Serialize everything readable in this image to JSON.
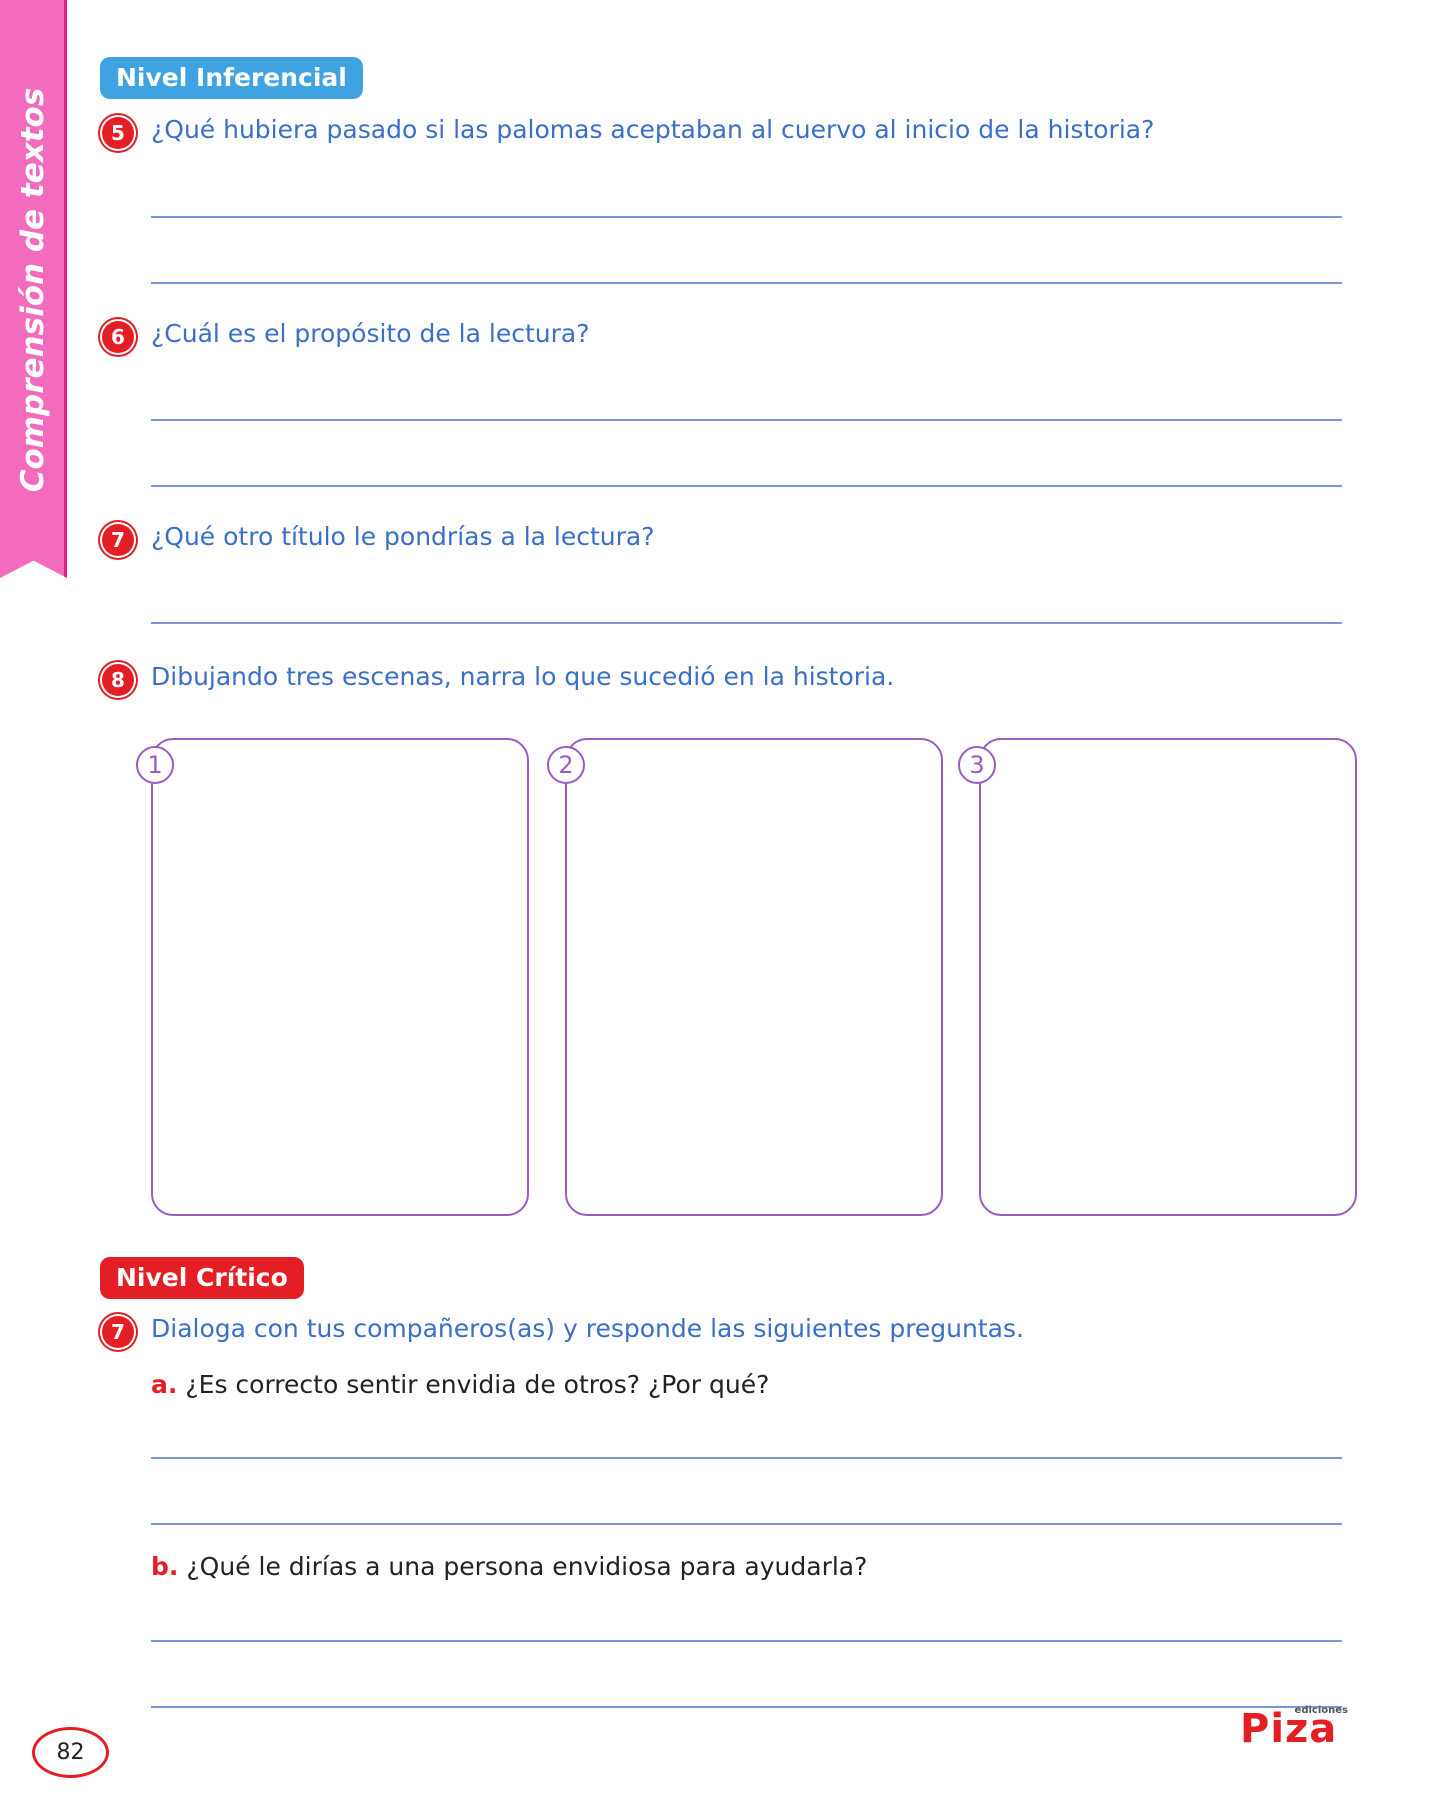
{
  "sidebar": {
    "label": "Comprensión de textos",
    "color": "#f26bbd"
  },
  "inferencial": {
    "badge": "Nivel Inferencial",
    "badge_color": "#3ea3e0",
    "questions": [
      {
        "number": "5",
        "text": "¿Qué hubiera pasado si las palomas aceptaban al cuervo al inicio de la historia?"
      },
      {
        "number": "6",
        "text": "¿Cuál es el propósito de la lectura?"
      },
      {
        "number": "7",
        "text": "¿Qué otro título le pondrías a la lectura?"
      },
      {
        "number": "8",
        "text": "Dibujando tres escenas, narra lo que sucedió en la historia."
      }
    ],
    "scenes": [
      "1",
      "2",
      "3"
    ]
  },
  "critico": {
    "badge": "Nivel Crítico",
    "badge_color": "#e31e25",
    "question": {
      "number": "7",
      "text": "Dialoga con tus compañeros(as) y responde las siguientes preguntas."
    },
    "items": [
      {
        "letter": "a.",
        "text": "¿Es correcto sentir envidia de otros? ¿Por qué?"
      },
      {
        "letter": "b.",
        "text": "¿Qué le dirías a una persona envidiosa para ayudarla?"
      }
    ]
  },
  "footer": {
    "page_number": "82",
    "logo_small": "ediciones",
    "logo_main": "Piza"
  }
}
